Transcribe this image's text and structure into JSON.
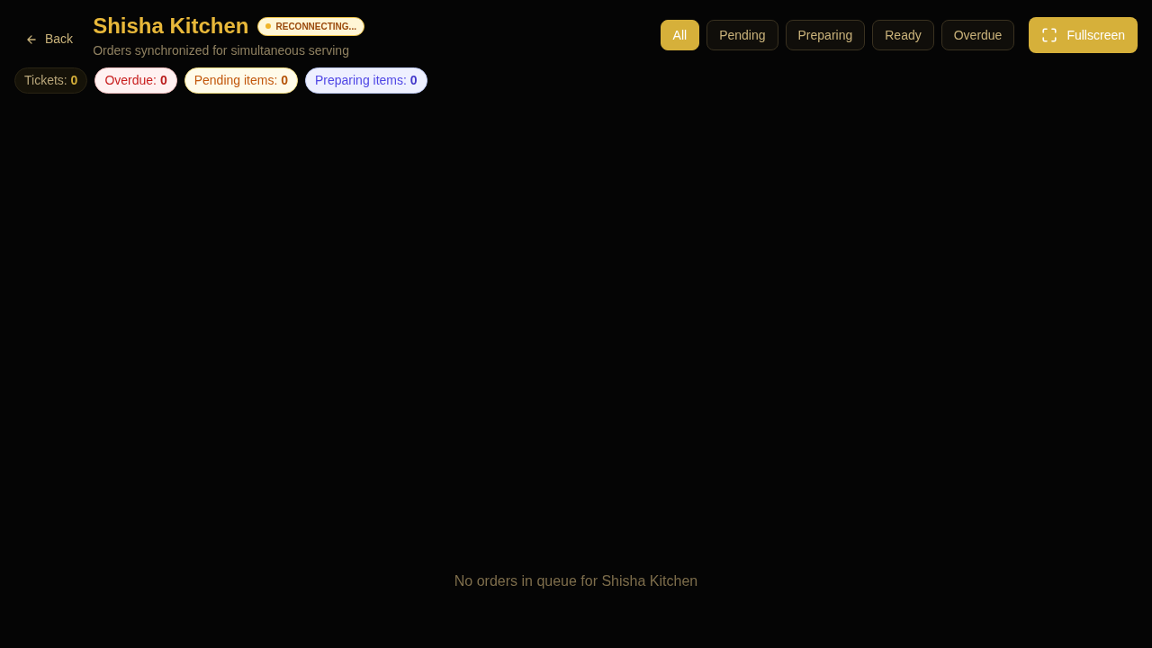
{
  "header": {
    "back": {
      "label": "Back"
    },
    "title": "Shisha Kitchen",
    "status": {
      "label": "RECONNECTING...",
      "kind": "warning"
    },
    "subtitle": "Orders synchronized for simultaneous serving"
  },
  "filters": [
    {
      "label": "All",
      "selected": true
    },
    {
      "label": "Pending",
      "selected": false
    },
    {
      "label": "Preparing",
      "selected": false
    },
    {
      "label": "Ready",
      "selected": false
    },
    {
      "label": "Overdue",
      "selected": false
    }
  ],
  "fullscreen_button": {
    "label": "Fullscreen"
  },
  "stats": [
    {
      "label": "Tickets:",
      "value": "0",
      "kind": "neutral"
    },
    {
      "label": "Overdue:",
      "value": "0",
      "kind": "danger"
    },
    {
      "label": "Pending items:",
      "value": "0",
      "kind": "warning"
    },
    {
      "label": "Preparing items:",
      "value": "0",
      "kind": "info"
    }
  ],
  "empty_message": "No orders in queue for Shisha Kitchen"
}
